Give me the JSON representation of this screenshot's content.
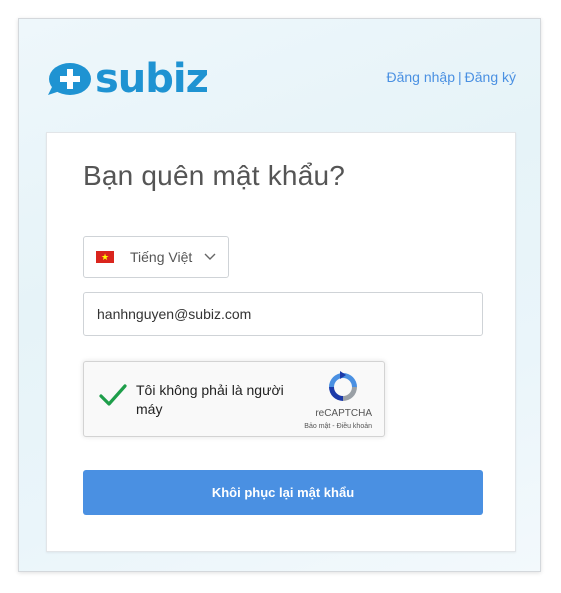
{
  "brand": {
    "logo_text": "subiz",
    "color": "#1f93d2",
    "icon": "speech-bubble-plus-icon"
  },
  "nav": {
    "login": "Đăng nhập",
    "separator": "|",
    "register": "Đăng ký",
    "link_color": "#4a90e2"
  },
  "form": {
    "title": "Bạn quên mật khẩu?",
    "language": {
      "selected": "Tiếng Việt",
      "flag_icon": "vietnam-flag-icon",
      "dropdown_icon": "chevron-down-icon"
    },
    "email": {
      "value": "hanhnguyen@subiz.com"
    },
    "recaptcha": {
      "label": "Tôi không phải là người máy",
      "checked": true,
      "brand": "reCAPTCHA",
      "terms": "Bảo mật - Điều khoản"
    },
    "submit_label": "Khôi phục lại mật khẩu",
    "accent": "#4a90e2"
  }
}
